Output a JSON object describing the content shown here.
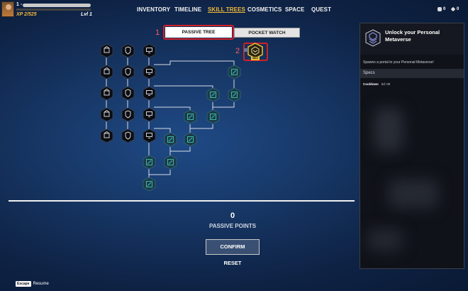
{
  "player": {
    "name_prefix": "1 -",
    "xp": "XP 2/525",
    "level": "Lvl 1",
    "xp_fraction": 0.004
  },
  "nav": {
    "items": [
      {
        "label": "INVENTORY",
        "active": false
      },
      {
        "label": "TIMELINE",
        "active": false
      },
      {
        "label": "SKILL TREES",
        "active": true
      },
      {
        "label": "COSMETICS",
        "active": false
      },
      {
        "label": "SPACE",
        "active": false
      },
      {
        "label": "QUEST",
        "active": false
      }
    ],
    "accent": "#f0b93a"
  },
  "currency": {
    "coins": "0",
    "gems": "0"
  },
  "tabs": {
    "passive": "PASSIVE TREE",
    "pocket": "POCKET WATCH"
  },
  "callouts": {
    "one": "1",
    "two": "2"
  },
  "tree": {
    "selected_node_label": "MAX",
    "node_states": {
      "locked_color": "#0b0d12",
      "available_color": "#1c3a4a",
      "available_icon": "#3ec7b0",
      "selected_color": "#e8c23a"
    }
  },
  "footer": {
    "points_value": "0",
    "points_label": "PASSIVE POINTS",
    "confirm": "CONFIRM",
    "reset": "RESET",
    "escape_key": "Escape",
    "escape_label": "Resume"
  },
  "panel": {
    "title": "Unlock your Personal Metaverse",
    "description": "Spawns a portal to your Personal Metaverse!",
    "specs_label": "Specs",
    "cooldown_label": "Cooldown",
    "cooldown_value": "0d: 00"
  },
  "colors": {
    "highlight_red": "#d0202a"
  }
}
